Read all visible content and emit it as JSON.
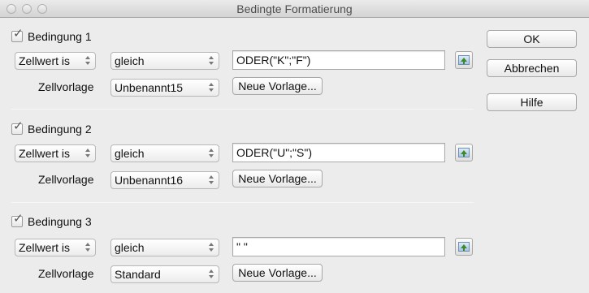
{
  "window": {
    "title": "Bedingte Formatierung"
  },
  "conditions": [
    {
      "title": "Bedingung 1",
      "type": "Zellwert is",
      "operator": "gleich",
      "value": "ODER(\"K\";\"F\")",
      "style_label": "Zellvorlage",
      "style": "Unbenannt15",
      "new_style_button": "Neue Vorlage..."
    },
    {
      "title": "Bedingung 2",
      "type": "Zellwert is",
      "operator": "gleich",
      "value": "ODER(\"U\";\"S\")",
      "style_label": "Zellvorlage",
      "style": "Unbenannt16",
      "new_style_button": "Neue Vorlage..."
    },
    {
      "title": "Bedingung 3",
      "type": "Zellwert is",
      "operator": "gleich",
      "value": "\" \"",
      "style_label": "Zellvorlage",
      "style": "Standard",
      "new_style_button": "Neue Vorlage..."
    }
  ],
  "buttons": {
    "ok": "OK",
    "cancel": "Abbrechen",
    "help": "Hilfe"
  },
  "icons": {
    "window_controls": [
      "close-icon",
      "minimize-icon",
      "zoom-icon"
    ],
    "checkbox": "checkmark-icon",
    "shrink": "shrink-dialog-icon",
    "popup": "updown-arrows-icon"
  }
}
